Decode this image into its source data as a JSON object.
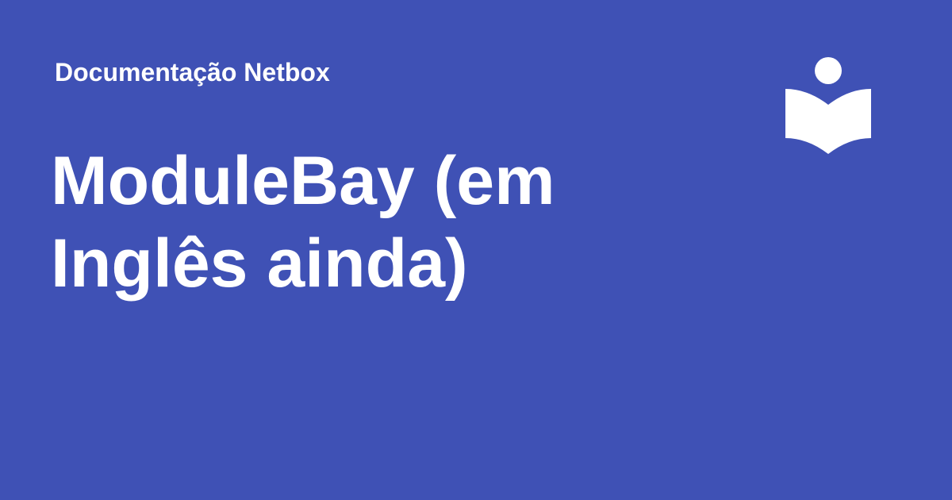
{
  "header": {
    "site_name": "Documentação Netbox"
  },
  "main": {
    "title": "ModuleBay (em Inglês ainda)"
  },
  "logo": {
    "icon": "reader-book-icon"
  },
  "colors": {
    "background": "#3f51b5",
    "foreground": "#ffffff"
  }
}
